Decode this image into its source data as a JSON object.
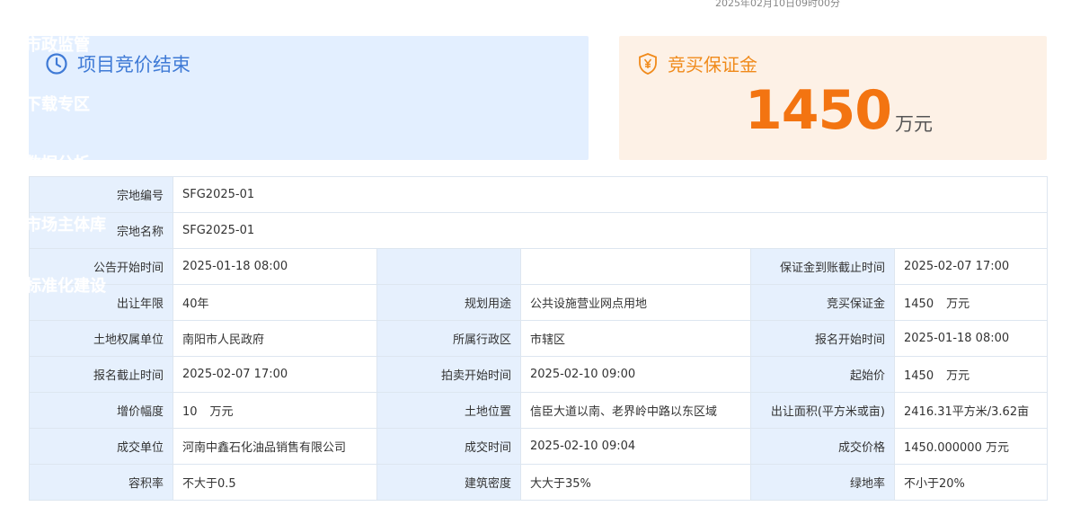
{
  "top_timestamp": "2025年02月10日09时00分",
  "sidebar_ghost_items": [
    "市政监管",
    "下载专区",
    "数据分析",
    "市场主体库",
    "标准化建设"
  ],
  "status": {
    "text": "项目竞价结束",
    "icon": "clock-icon",
    "color": "#3f7ad6"
  },
  "deposit": {
    "label": "竞买保证金",
    "value": "1450",
    "unit": "万元",
    "icon": "shield-yen-icon",
    "color": "#f37411"
  },
  "details": {
    "parcel_no_label": "宗地编号",
    "parcel_no": "SFG2025-01",
    "parcel_name_label": "宗地名称",
    "parcel_name": "SFG2025-01",
    "announce_start_label": "公告开始时间",
    "announce_start": "2025-01-18 08:00",
    "deposit_deadline_label": "保证金到账截止时间",
    "deposit_deadline": "2025-02-07 17:00",
    "term_label": "出让年限",
    "term": "40年",
    "usage_label": "规划用途",
    "usage": "公共设施营业网点用地",
    "bid_deposit_label": "竞买保证金",
    "bid_deposit": "1450",
    "bid_deposit_unit": "万元",
    "owner_label": "土地权属单位",
    "owner": "南阳市人民政府",
    "district_label": "所属行政区",
    "district": "市辖区",
    "reg_start_label": "报名开始时间",
    "reg_start": "2025-01-18 08:00",
    "reg_end_label": "报名截止时间",
    "reg_end": "2025-02-07 17:00",
    "auction_start_label": "拍卖开始时间",
    "auction_start": "2025-02-10 09:00",
    "start_price_label": "起始价",
    "start_price": "1450",
    "start_price_unit": "万元",
    "increment_label": "增价幅度",
    "increment": "10",
    "increment_unit": "万元",
    "location_label": "土地位置",
    "location": "信臣大道以南、老界岭中路以东区域",
    "area_label": "出让面积(平方米或亩)",
    "area": "2416.31平方米/3.62亩",
    "winner_label": "成交单位",
    "winner": "河南中鑫石化油品销售有限公司",
    "deal_time_label": "成交时间",
    "deal_time": "2025-02-10 09:04",
    "deal_price_label": "成交价格",
    "deal_price": "1450.000000 万元",
    "far_label": "容积率",
    "far": "不大于0.5",
    "density_label": "建筑密度",
    "density": "大大于35%",
    "green_label": "绿地率",
    "green": "不小于20%"
  }
}
